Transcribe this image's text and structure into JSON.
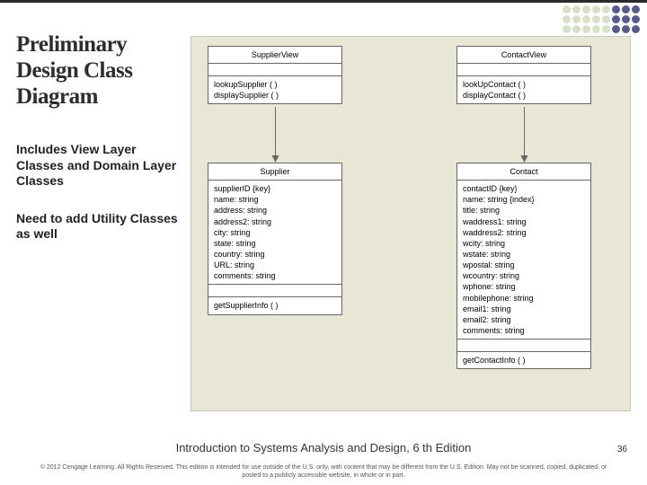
{
  "title": "Preliminary Design Class Diagram",
  "sub1": "Includes View Layer Classes and Domain Layer Classes",
  "sub2": "Need to add Utility Classes as well",
  "classes": {
    "supplierView": {
      "name": "SupplierView",
      "methods": "lookupSupplier ( )\ndisplaySupplier ( )"
    },
    "contactView": {
      "name": "ContactView",
      "methods": "lookUpContact ( )\ndisplayContact ( )"
    },
    "supplier": {
      "name": "Supplier",
      "attrs": "supplierID {key}\nname: string\naddress: string\naddress2: string\ncity: string\nstate: string\ncountry: string\nURL: string\ncomments: string",
      "methods": "getSupplierInfo ( )"
    },
    "contact": {
      "name": "Contact",
      "attrs": "contactID {key}\nname: string {index}\ntitle: string\nwaddress1: string\nwaddress2: string\nwcity: string\nwstate: string\nwpostal: string\nwcountry: string\nwphone: string\nmobilephone: string\nemail1: string\nemail2: string\ncomments: string",
      "methods": "getContactInfo ( )"
    }
  },
  "footer_title": "Introduction to Systems Analysis and Design, 6 th Edition",
  "page_num": "36",
  "copyright": "© 2012 Cengage Learning. All Rights Reserved. This edition is intended for use outside of the U.S. only, with content that may be different from the U.S. Edition. May not be scanned, copied, duplicated, or posted to a publicly accessible website, in whole or in part."
}
